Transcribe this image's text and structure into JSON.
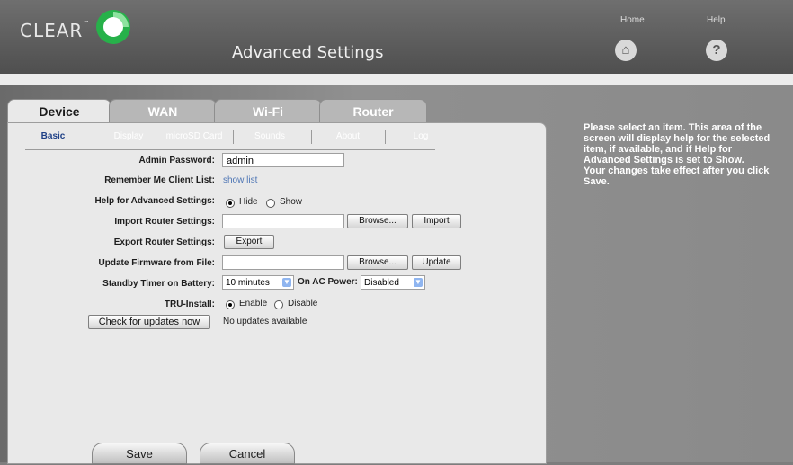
{
  "brand": {
    "name": "CLEAR",
    "trademark": "™"
  },
  "header": {
    "title": "Advanced Settings",
    "nav": [
      {
        "label": "Home",
        "icon": "home-icon"
      },
      {
        "label": "Help",
        "icon": "help-icon"
      }
    ]
  },
  "tabs": [
    {
      "label": "Device",
      "active": true
    },
    {
      "label": "WAN"
    },
    {
      "label": "Wi-Fi"
    },
    {
      "label": "Router"
    }
  ],
  "subtabs": [
    {
      "label": "Basic",
      "active": true
    },
    {
      "label": "Display"
    },
    {
      "label": "microSD Card"
    },
    {
      "label": "Sounds"
    },
    {
      "label": "About"
    },
    {
      "label": "Log"
    }
  ],
  "form": {
    "admin_password": {
      "label": "Admin Password:",
      "value": "admin"
    },
    "remember_client": {
      "label": "Remember Me Client List:",
      "link": "show list"
    },
    "help_advanced": {
      "label": "Help for Advanced Settings:",
      "opt_hide": "Hide",
      "opt_show": "Show",
      "selected": "Hide"
    },
    "import": {
      "label": "Import Router Settings:",
      "browse": "Browse...",
      "action": "Import"
    },
    "export": {
      "label": "Export Router Settings:",
      "action": "Export"
    },
    "firmware": {
      "label": "Update Firmware from File:",
      "browse": "Browse...",
      "action": "Update"
    },
    "standby": {
      "label": "Standby Timer on Battery:",
      "battery_value": "10 minutes",
      "ac_label": "On AC Power:",
      "ac_value": "Disabled"
    },
    "tru_install": {
      "label": "TRU-Install:",
      "opt_enable": "Enable",
      "opt_disable": "Disable",
      "selected": "Enable"
    },
    "updates": {
      "button": "Check for updates now",
      "status": "No updates available"
    }
  },
  "footer": {
    "save": "Save",
    "cancel": "Cancel"
  },
  "help": {
    "lines": [
      "Please select an item. This area of the screen will display help for the selected item, if available, and if Help for Advanced Settings is set to Show.",
      "Your changes take effect after you click Save."
    ]
  }
}
